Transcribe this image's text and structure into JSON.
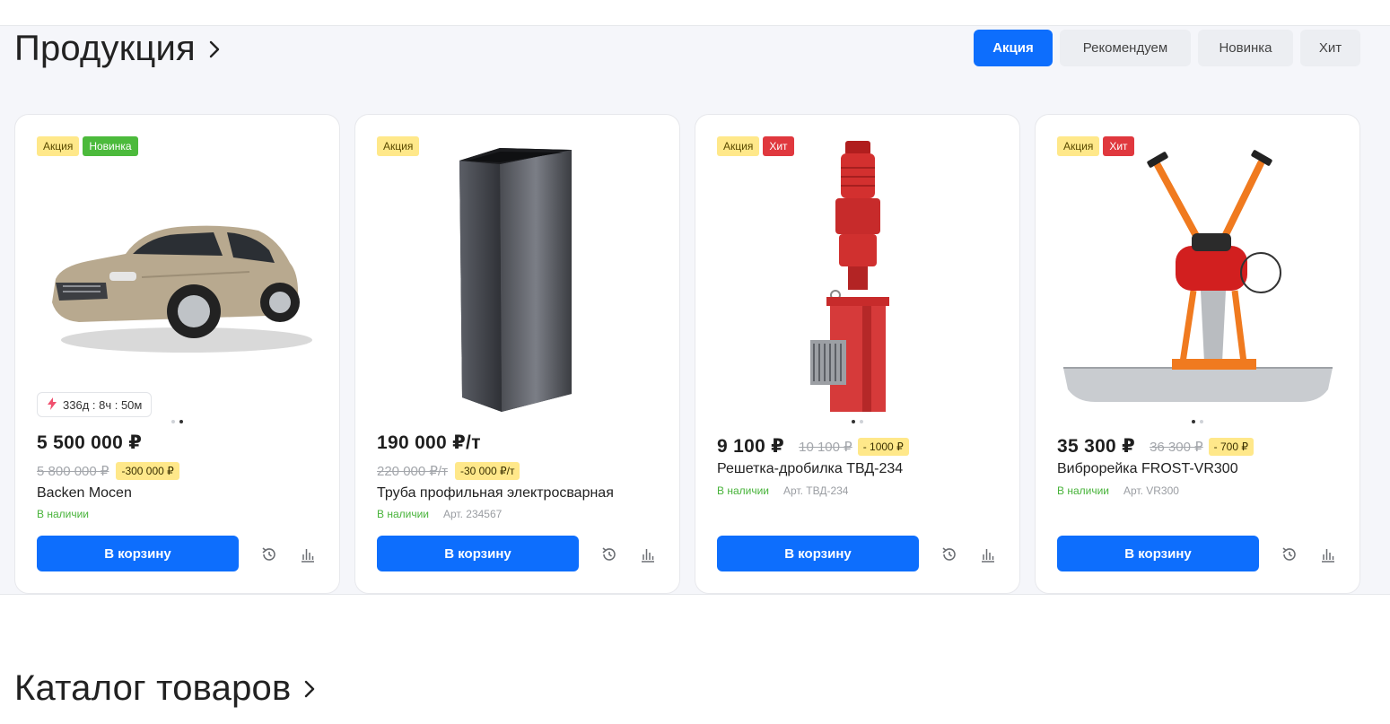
{
  "products_section": {
    "title": "Продукция",
    "filters": [
      "Акция",
      "Рекомендуем",
      "Новинка",
      "Хит"
    ]
  },
  "products": [
    {
      "badges": [
        "Акция",
        "Новинка"
      ],
      "image": "porsche-macan-car",
      "timer": "336д : 8ч : 50м",
      "price": "5 500 000 ₽",
      "old_price": "5 800 000 ₽",
      "discount": "-300 000 ₽",
      "name": "Backen Mocen",
      "stock": "В наличии",
      "article": "",
      "cart_label": "В корзину"
    },
    {
      "badges": [
        "Акция"
      ],
      "image": "rectangular-steel-pipe",
      "price": "190 000 ₽/т",
      "old_price": "220 000 ₽/т",
      "discount": "-30 000 ₽/т",
      "name": "Труба профильная электросварная",
      "stock": "В наличии",
      "article": "Арт. 234567",
      "cart_label": "В корзину"
    },
    {
      "badges": [
        "Акция",
        "Хит"
      ],
      "image": "red-grinder-crusher",
      "price": "9 100 ₽",
      "old_price": "10 100 ₽",
      "discount": "- 1000 ₽",
      "name": "Решетка-дробилка ТВД-234",
      "stock": "В наличии",
      "article": "Арт. ТВД-234",
      "cart_label": "В корзину"
    },
    {
      "badges": [
        "Акция",
        "Хит"
      ],
      "image": "vibrating-screed",
      "price": "35 300 ₽",
      "old_price": "36 300 ₽",
      "discount": "- 700 ₽",
      "name": "Виброрейка FROST-VR300",
      "stock": "В наличии",
      "article": "Арт. VR300",
      "cart_label": "В корзину"
    }
  ],
  "catalog_section": {
    "title": "Каталог товаров"
  },
  "colors": {
    "accent": "#0d6efd",
    "promo_badge": "#ffe88a",
    "new_badge": "#4cba3c",
    "hit_badge": "#e0383e",
    "in_stock": "#47b339"
  }
}
